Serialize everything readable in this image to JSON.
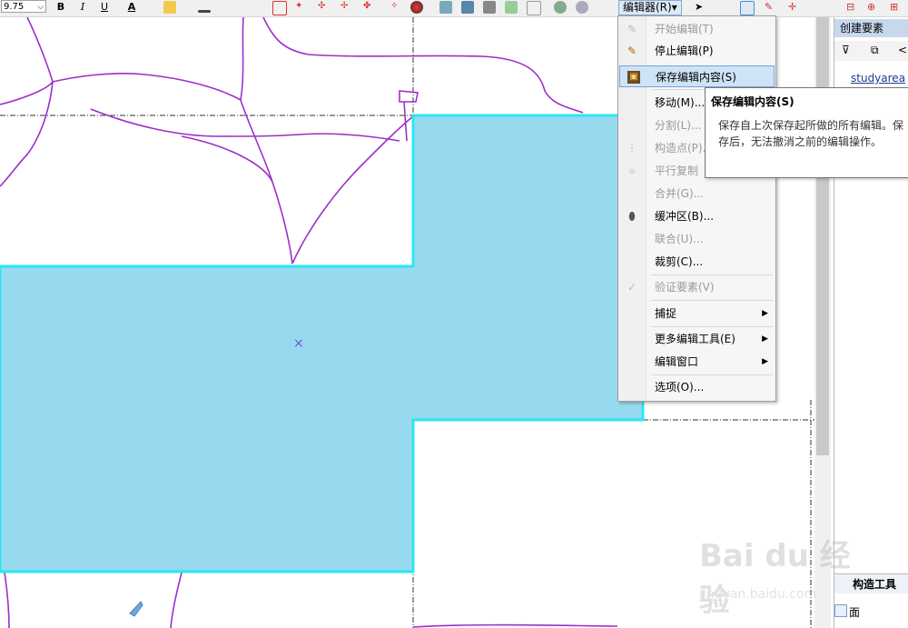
{
  "toolbar": {
    "font_size": "9.75",
    "bold": "B",
    "italic": "I",
    "underline": "U",
    "font_color": "A",
    "editor_menu": "编辑器(R)▾"
  },
  "editor_menu": {
    "items": [
      {
        "label": "开始编辑(T)",
        "disabled": true,
        "icon": "pencil-start-icon"
      },
      {
        "label": "停止编辑(P)",
        "disabled": false,
        "icon": "pencil-stop-icon"
      },
      {
        "label": "保存编辑内容(S)",
        "disabled": false,
        "icon": "save-edits-icon",
        "highlighted": true
      },
      {
        "label": "移动(M)...",
        "disabled": false,
        "icon": ""
      },
      {
        "label": "分割(L)...",
        "disabled": true,
        "icon": ""
      },
      {
        "label": "构造点(P)...",
        "disabled": true,
        "icon": "construct-points-icon"
      },
      {
        "label": "平行复制",
        "disabled": true,
        "icon": "parallel-copy-icon"
      },
      {
        "label": "合并(G)...",
        "disabled": true,
        "icon": ""
      },
      {
        "label": "缓冲区(B)...",
        "disabled": false,
        "icon": "buffer-icon"
      },
      {
        "label": "联合(U)...",
        "disabled": true,
        "icon": ""
      },
      {
        "label": "裁剪(C)...",
        "disabled": false,
        "icon": ""
      },
      {
        "label": "验证要素(V)",
        "disabled": true,
        "icon": "validate-icon"
      },
      {
        "label": "捕捉",
        "disabled": false,
        "icon": "",
        "submenu": true
      },
      {
        "label": "更多编辑工具(E)",
        "disabled": false,
        "icon": "",
        "submenu": true
      },
      {
        "label": "编辑窗口",
        "disabled": false,
        "icon": "",
        "submenu": true
      },
      {
        "label": "选项(O)...",
        "disabled": false,
        "icon": ""
      }
    ]
  },
  "tooltip": {
    "title": "保存编辑内容(S)",
    "body": "保存自上次保存起所做的所有编辑。保存后，无法撤消之前的编辑操作。"
  },
  "create_features_panel": {
    "title": "创建要素",
    "layer": "studyarea"
  },
  "construct_tools": {
    "title": "构造工具",
    "item": "面"
  },
  "watermark": {
    "logo": "Bai du 经验",
    "url": "jingyan.baidu.com"
  },
  "colors": {
    "polygon_fill": "#97d9ef",
    "polygon_outline": "#28e8f0",
    "roads": "#9b30c8",
    "menu_highlight": "#cfe3f7"
  }
}
